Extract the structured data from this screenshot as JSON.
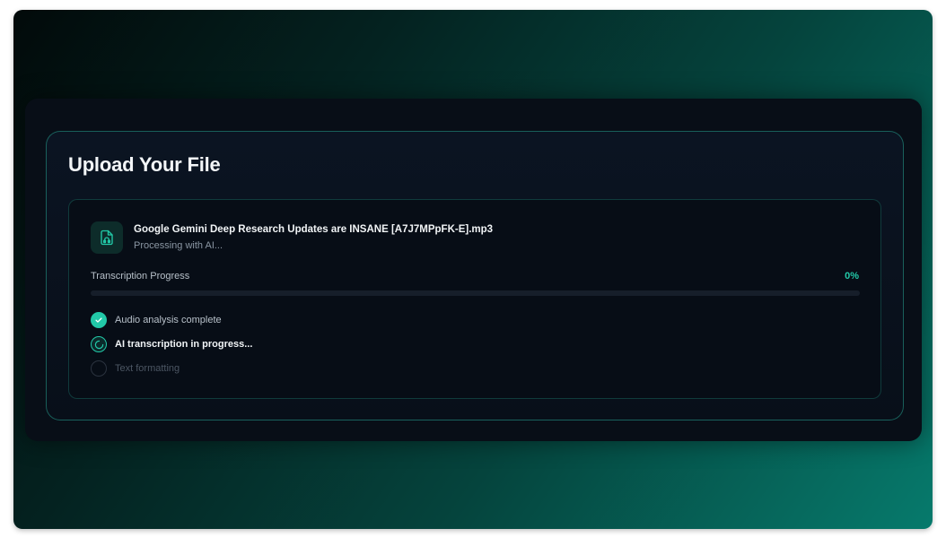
{
  "upload": {
    "title": "Upload Your File",
    "file": {
      "name": "Google Gemini Deep Research Updates are INSANE [A7J7MPpFK-E].mp3",
      "status": "Processing with AI...",
      "icon": "audio-file-icon"
    },
    "progress": {
      "label": "Transcription Progress",
      "percent_text": "0%",
      "value": 0
    },
    "steps": [
      {
        "label": "Audio analysis complete",
        "state": "complete",
        "icon": "check-icon"
      },
      {
        "label": "AI transcription in progress...",
        "state": "in-progress",
        "icon": "spinner-icon"
      },
      {
        "label": "Text formatting",
        "state": "pending",
        "icon": "empty-circle-icon"
      }
    ]
  },
  "colors": {
    "accent": "#22c9a8",
    "panel_bg": "#080e17",
    "card_border": "#26a08e",
    "text_primary": "#f1f4f6",
    "text_muted": "#8a96a3"
  }
}
